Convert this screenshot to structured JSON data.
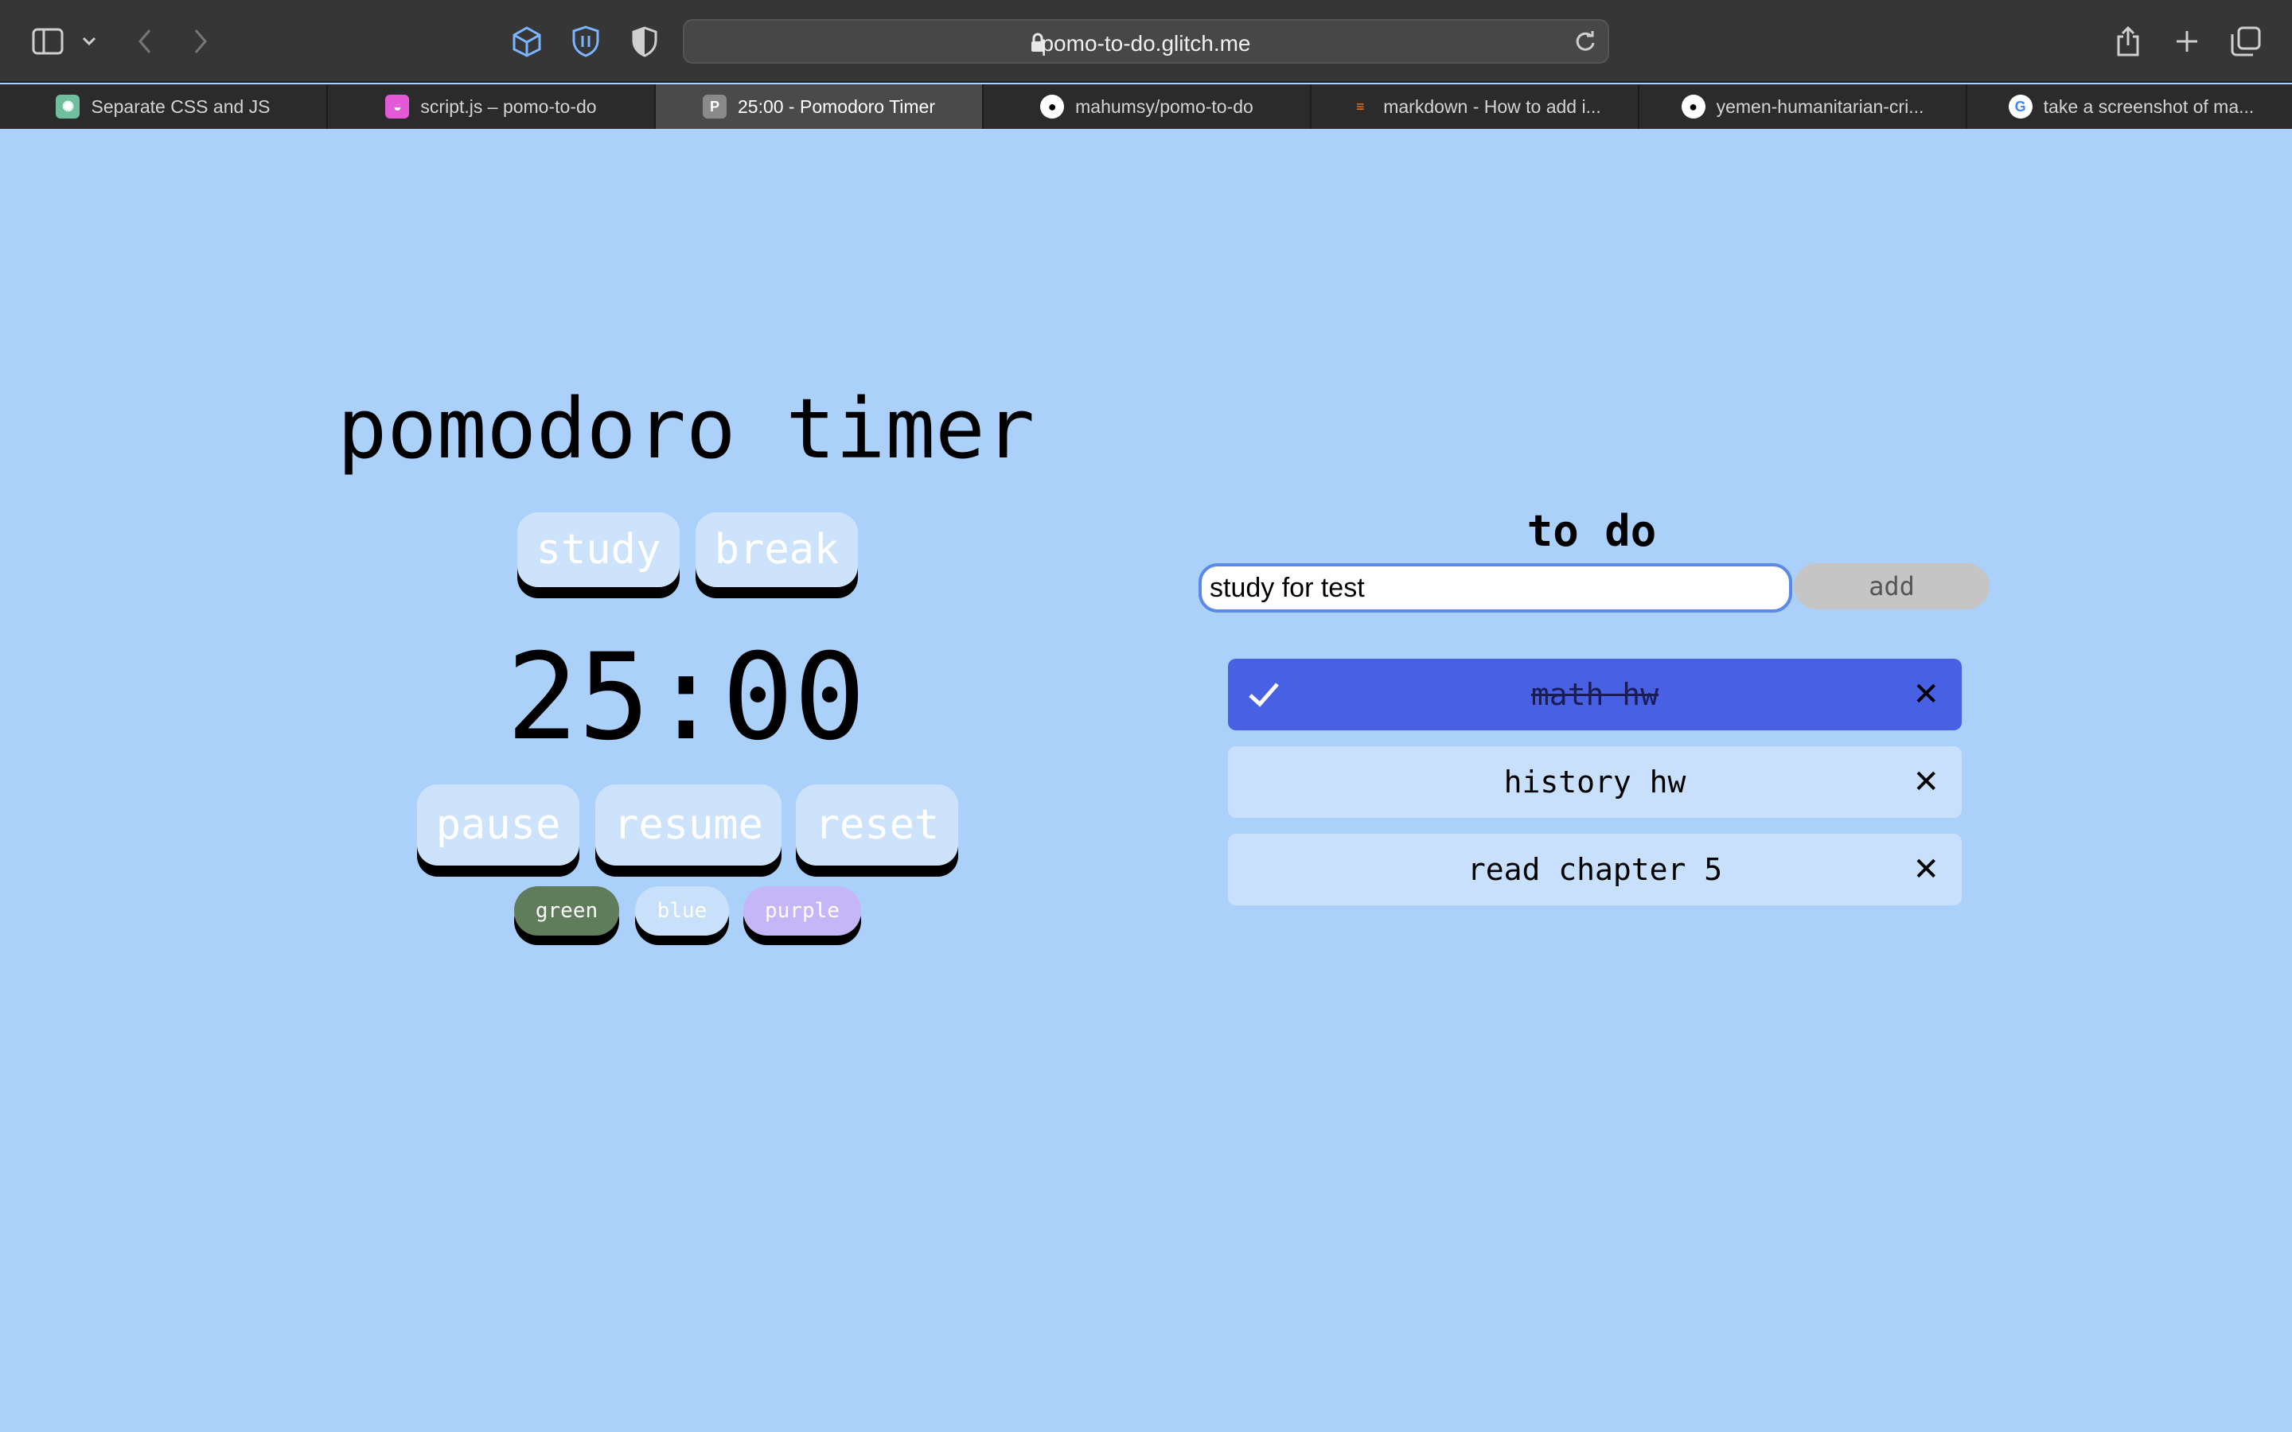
{
  "browser": {
    "url": "pomo-to-do.glitch.me",
    "tabs": [
      {
        "label": "Separate CSS and JS",
        "favicon": "chatgpt-icon",
        "color": "#6fbf9f"
      },
      {
        "label": "script.js – pomo-to-do",
        "favicon": "glitch-icon",
        "color": "#e45ad6"
      },
      {
        "label": "25:00 - Pomodoro Timer",
        "favicon": "P",
        "color": "#6b6b6b",
        "active": true
      },
      {
        "label": "mahumsy/pomo-to-do",
        "favicon": "github-icon",
        "color": "#ffffff"
      },
      {
        "label": "markdown - How to add i...",
        "favicon": "stackoverflow-icon",
        "color": "#f48024"
      },
      {
        "label": "yemen-humanitarian-cri...",
        "favicon": "github-icon",
        "color": "#ffffff"
      },
      {
        "label": "take a screenshot of ma...",
        "favicon": "google-icon",
        "color": "#4285f4"
      }
    ]
  },
  "timer": {
    "title": "pomodoro timer",
    "modes": [
      "study",
      "break"
    ],
    "time": "25:00",
    "controls": [
      "pause",
      "resume",
      "reset"
    ],
    "themes": [
      {
        "label": "green",
        "color": "#5f7d5b"
      },
      {
        "label": "blue",
        "color": "#c9e0fa"
      },
      {
        "label": "purple",
        "color": "#c5b7f7"
      }
    ]
  },
  "todo": {
    "title": "to do",
    "input_value": "study for test",
    "add_label": "add",
    "items": [
      {
        "text": "math hw",
        "done": true
      },
      {
        "text": "history hw",
        "done": false
      },
      {
        "text": "read chapter 5",
        "done": false
      }
    ]
  }
}
